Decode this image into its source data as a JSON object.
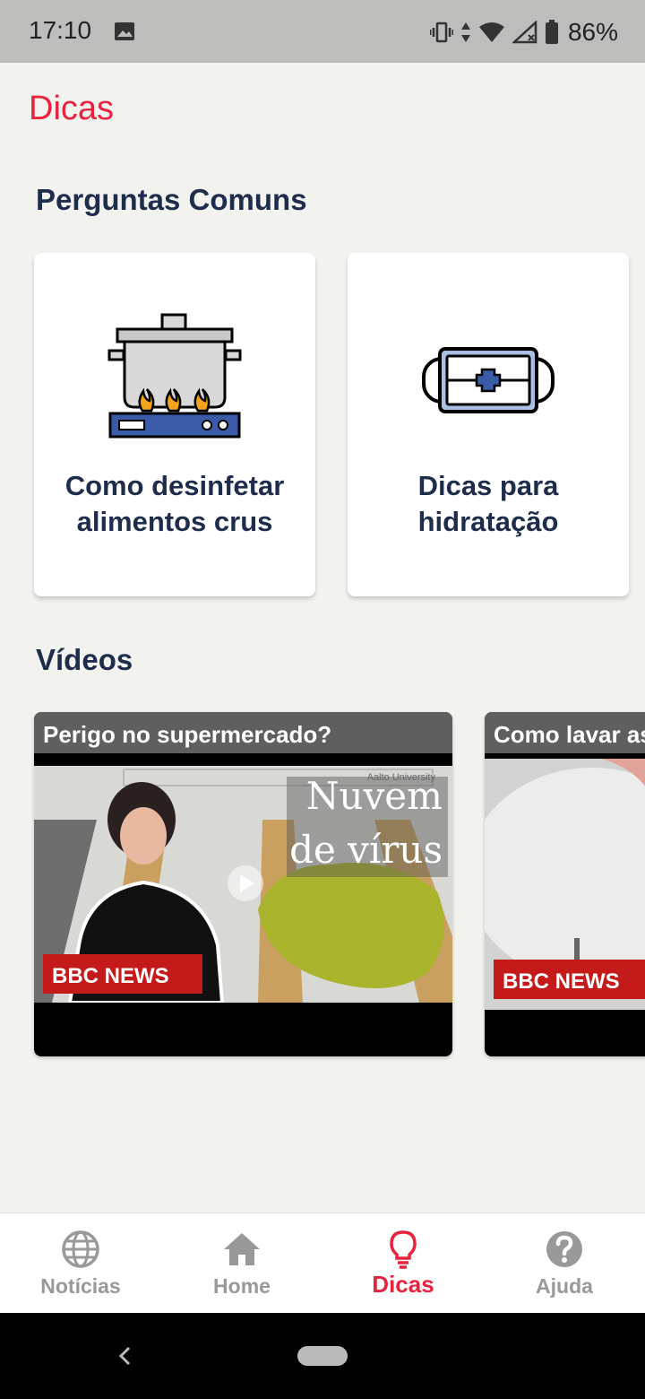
{
  "status": {
    "time": "17:10",
    "battery": "86%"
  },
  "app": {
    "title": "Dicas"
  },
  "sections": {
    "faq_title": "Perguntas Comuns",
    "videos_title": "Vídeos"
  },
  "faq": [
    {
      "label": "Como desinfetar alimentos crus",
      "icon": "cooking-pot-icon"
    },
    {
      "label": "Dicas para hidratação",
      "icon": "first-aid-kit-icon"
    }
  ],
  "videos": [
    {
      "title": "Perigo no supermercado?",
      "overlay_line1": "Nuvem",
      "overlay_line2": "de vírus",
      "badge": "BBC NEWS",
      "source": "Aalto University"
    },
    {
      "title": "Como lavar as",
      "badge": "BBC NEWS"
    }
  ],
  "nav": [
    {
      "label": "Notícias",
      "icon": "globe-icon"
    },
    {
      "label": "Home",
      "icon": "home-icon"
    },
    {
      "label": "Dicas",
      "icon": "lightbulb-icon",
      "active": true
    },
    {
      "label": "Ajuda",
      "icon": "help-icon"
    }
  ],
  "colors": {
    "accent": "#e8233e",
    "heading": "#1f2d4d",
    "inactive": "#999999"
  }
}
